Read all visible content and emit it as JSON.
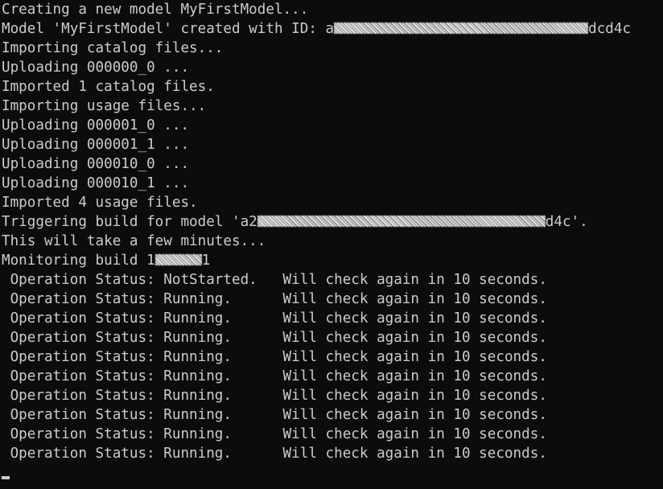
{
  "console": {
    "lines": [
      {
        "text": "Creating a new model MyFirstModel..."
      },
      {
        "prefix": "Model 'MyFirstModel' created with ID: a",
        "redacted": true,
        "suffix": "dcd4c"
      },
      {
        "text": "Importing catalog files..."
      },
      {
        "text": "Uploading 000000_0 ..."
      },
      {
        "text": "Imported 1 catalog files."
      },
      {
        "text": "Importing usage files..."
      },
      {
        "text": "Uploading 000001_0 ..."
      },
      {
        "text": "Uploading 000001_1 ..."
      },
      {
        "text": "Uploading 000010_0 ..."
      },
      {
        "text": "Uploading 000010_1 ..."
      },
      {
        "text": "Imported 4 usage files."
      },
      {
        "prefix": "Triggering build for model 'a2",
        "redacted": true,
        "suffix": "d4c'."
      },
      {
        "text": "This will take a few minutes..."
      },
      {
        "prefix": "Monitoring build 1",
        "redacted": true,
        "suffix": "1"
      },
      {
        "text": " Operation Status: NotStarted.   Will check again in 10 seconds."
      },
      {
        "text": " Operation Status: Running.      Will check again in 10 seconds."
      },
      {
        "text": " Operation Status: Running.      Will check again in 10 seconds."
      },
      {
        "text": " Operation Status: Running.      Will check again in 10 seconds."
      },
      {
        "text": " Operation Status: Running.      Will check again in 10 seconds."
      },
      {
        "text": " Operation Status: Running.      Will check again in 10 seconds."
      },
      {
        "text": " Operation Status: Running.      Will check again in 10 seconds."
      },
      {
        "text": " Operation Status: Running.      Will check again in 10 seconds."
      },
      {
        "text": " Operation Status: Running.      Will check again in 10 seconds."
      },
      {
        "text": " Operation Status: Running.      Will check again in 10 seconds."
      }
    ]
  },
  "colors": {
    "background": "#0c0c0c",
    "foreground": "#cccccc"
  }
}
